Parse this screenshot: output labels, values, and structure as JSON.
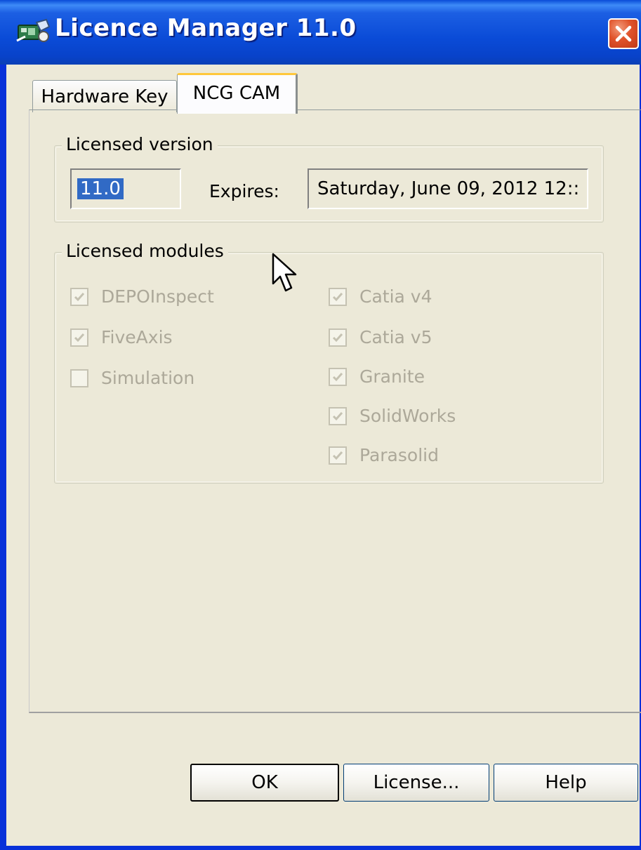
{
  "window": {
    "title": "Licence Manager 11.0",
    "icons": {
      "app": "licence-manager-icon",
      "close": "close-icon"
    },
    "colors": {
      "titlebar": "#0a4bd7",
      "close": "#e0522a",
      "face": "#ece9d8",
      "selection": "#316ac5"
    }
  },
  "tabs": [
    {
      "label": "Hardware Key",
      "active": false
    },
    {
      "label": "NCG CAM",
      "active": true
    }
  ],
  "licensed_version": {
    "legend": "Licensed version",
    "version_value": "11.0",
    "expires_label": "Expires:",
    "expires_value": "Saturday, June 09, 2012 12::"
  },
  "licensed_modules": {
    "legend": "Licensed modules",
    "left": [
      {
        "label": "DEPOInspect",
        "checked": true
      },
      {
        "label": "FiveAxis",
        "checked": true
      },
      {
        "label": "Simulation",
        "checked": false
      }
    ],
    "right": [
      {
        "label": "Catia v4",
        "checked": true
      },
      {
        "label": "Catia v5",
        "checked": true
      },
      {
        "label": "Granite",
        "checked": true
      },
      {
        "label": "SolidWorks",
        "checked": true
      },
      {
        "label": "Parasolid",
        "checked": true
      }
    ]
  },
  "buttons": {
    "ok": "OK",
    "license": "License...",
    "help": "Help"
  }
}
